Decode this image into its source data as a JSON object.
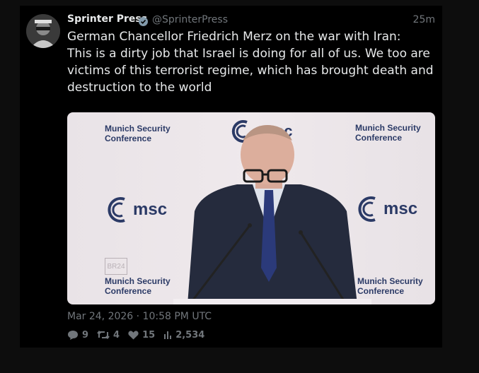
{
  "tweet": {
    "author_name": "Sprinter Press",
    "handle": "@SprinterPress",
    "time_ago": "25m",
    "text_lines": [
      "German Chancellor Friedrich Merz on the war with Iran:",
      "This is a dirty job that Israel is doing for all of us. We too are",
      "victims of this terrorist regime, which has brought death and",
      "destruction to the world"
    ],
    "timestamp": "Mar 24, 2026 · 10:58 PM UTC"
  },
  "media": {
    "conference_line1": "Munich Security",
    "conference_line2": "Conference",
    "logo_text": "msc",
    "logo_text_partial": "sc",
    "watermark": "BR24"
  },
  "stats": {
    "replies": "9",
    "retweets": "4",
    "likes": "15",
    "views": "2,534"
  },
  "colors": {
    "background": "#0d0d0d",
    "card": "#000000",
    "text": "#e7e9ea",
    "muted": "#71767b",
    "verified": "#829aab",
    "msc_navy": "#2b3a66"
  }
}
